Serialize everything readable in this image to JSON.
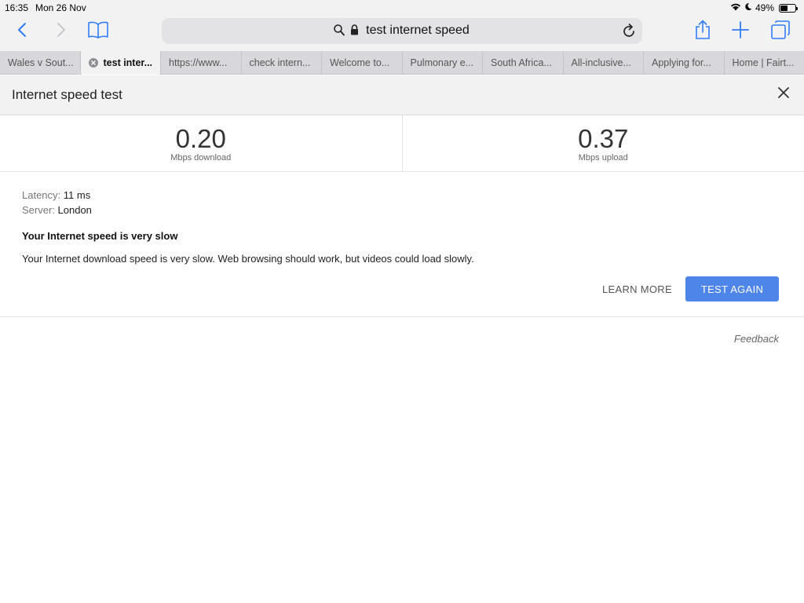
{
  "status": {
    "time": "16:35",
    "date": "Mon 26 Nov",
    "battery": "49%",
    "battery_level": 0.49
  },
  "toolbar": {
    "url": "test internet speed"
  },
  "tabs": [
    {
      "label": "Wales v Sout...",
      "active": false
    },
    {
      "label": "test inter...",
      "active": true
    },
    {
      "label": "https://www...",
      "active": false
    },
    {
      "label": "check intern...",
      "active": false
    },
    {
      "label": "Welcome to...",
      "active": false
    },
    {
      "label": "Pulmonary e...",
      "active": false
    },
    {
      "label": "South Africa...",
      "active": false
    },
    {
      "label": "All-inclusive...",
      "active": false
    },
    {
      "label": "Applying for...",
      "active": false
    },
    {
      "label": "Home | Fairt...",
      "active": false
    }
  ],
  "speedtest": {
    "title": "Internet speed test",
    "download": {
      "value": "0.20",
      "label": "Mbps download"
    },
    "upload": {
      "value": "0.37",
      "label": "Mbps upload"
    },
    "latency_label": "Latency:",
    "latency_value": "11 ms",
    "server_label": "Server:",
    "server_value": "London",
    "headline": "Your Internet speed is very slow",
    "description": "Your Internet download speed is very slow. Web browsing should work, but videos could load slowly.",
    "learn_more": "LEARN MORE",
    "test_again": "TEST AGAIN",
    "feedback": "Feedback"
  },
  "colors": {
    "accent": "#4d86e8",
    "ios_blue": "#2f7cf6"
  }
}
